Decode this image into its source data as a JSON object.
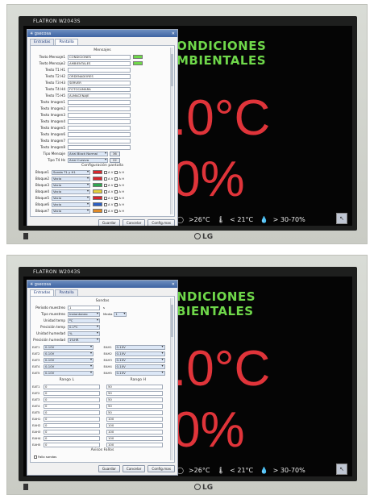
{
  "monitor": {
    "brand": "FLATRON",
    "model": "W2043S",
    "logo": "LG"
  },
  "background": {
    "title_line1": "NDICIONES",
    "title_line2": "BIENTALES",
    "title_line1_top": "ONDICIONES",
    "title_line2_top": "MBIENTALES",
    "temperature": ".0°C",
    "humidity": "0%",
    "legend": {
      "hot": ">26°C",
      "cold": "< 21°C",
      "humidity": "> 30-70%"
    },
    "colors": {
      "title": "#6fd84a",
      "value": "#e0343a"
    }
  },
  "dialog": {
    "title": "gsecosa",
    "tabs": [
      "Entradas",
      "Pantalla"
    ],
    "buttons": {
      "save": "Guardar",
      "cancel": "Cancelar",
      "config": "Config.mas"
    }
  },
  "pantalla": {
    "section_messages": "Mensajes",
    "texts": [
      {
        "label": "Texto Mensaje1",
        "value": "CONDICIONES"
      },
      {
        "label": "Texto Mensaje2",
        "value": "AMBIENTALES"
      },
      {
        "label": "Texto T1 H1",
        "value": ""
      },
      {
        "label": "Texto T2 H2",
        "value": "ORDENADORES"
      },
      {
        "label": "Texto T3 H3",
        "value": "SERVER"
      },
      {
        "label": "Texto T4 H4",
        "value": "FOTOCAMARA"
      },
      {
        "label": "Texto T5 H5",
        "value": "ALMACENAJE"
      },
      {
        "label": "Texto Imagen1",
        "value": ""
      },
      {
        "label": "Texto Imagen2",
        "value": ""
      },
      {
        "label": "Texto Imagen3",
        "value": ""
      },
      {
        "label": "Texto Imagen4",
        "value": ""
      },
      {
        "label": "Texto Imagen5",
        "value": ""
      },
      {
        "label": "Texto Imagen6",
        "value": ""
      },
      {
        "label": "Texto Imagen7",
        "value": ""
      },
      {
        "label": "Texto Imagen8",
        "value": ""
      }
    ],
    "tipo_mensaje": {
      "label": "Tipo Mensaje",
      "value": "Arial Black Normal",
      "size": "36"
    },
    "tipo_th": {
      "label": "Tipo T4 Hs",
      "value": "Arial Cursiva",
      "size": "22"
    },
    "section_config": "Configuración pantalla",
    "bloques": [
      {
        "label": "Bloque1",
        "value": "Sonda T1 y H1",
        "color": "#d8272d"
      },
      {
        "label": "Bloque2",
        "value": "Vacio",
        "color": "#d8272d"
      },
      {
        "label": "Bloque3",
        "value": "Vacio",
        "color": "#2fa84f"
      },
      {
        "label": "Bloque4",
        "value": "Vacio",
        "color": "#e4d23a"
      },
      {
        "label": "Bloque5",
        "value": "Vacio",
        "color": "#d8272d"
      },
      {
        "label": "Bloque6",
        "value": "Vacio",
        "color": "#2b5fc4"
      },
      {
        "label": "Bloque7",
        "value": "Vacio",
        "color": "#e08a26"
      }
    ],
    "chk_a": "A V",
    "chk_b": "A H"
  },
  "entradas": {
    "section_sondas": "Sondas",
    "periodo": {
      "label": "Periodo muestreo",
      "value": "1",
      "unit": "s"
    },
    "tipo_muestreo": {
      "label": "Tipo muestreo",
      "value": "Instantaneo",
      "media_label": "Media",
      "media_value": "1"
    },
    "unidad_temp": {
      "label": "Unidad temp",
      "value": "ºC"
    },
    "precision_temp": {
      "label": "Precisión temp",
      "value": "0.1ºC"
    },
    "unidad_hum": {
      "label": "Unidad humedad",
      "value": "%"
    },
    "precision_hum": {
      "label": "Precisión humedad",
      "value": "1%HR"
    },
    "channels_left": [
      {
        "label": "EAT1",
        "value": "0-10V"
      },
      {
        "label": "EAT2",
        "value": "0-10V"
      },
      {
        "label": "EAT3",
        "value": "0-10V"
      },
      {
        "label": "EAT4",
        "value": "0-10V"
      },
      {
        "label": "EAT5",
        "value": "0-10V"
      }
    ],
    "channels_right": [
      {
        "label": "EAH1",
        "value": "0-10V"
      },
      {
        "label": "EAH2",
        "value": "0-10V"
      },
      {
        "label": "EAH3",
        "value": "0-10V"
      },
      {
        "label": "EAH4",
        "value": "0-10V"
      },
      {
        "label": "EAH5",
        "value": "0-10V"
      }
    ],
    "rango_l": "Rango L",
    "rango_h": "Rango H",
    "ranges": [
      {
        "label": "EAT1",
        "l": "0",
        "h": "50"
      },
      {
        "label": "EAT2",
        "l": "0",
        "h": "50"
      },
      {
        "label": "EAT3",
        "l": "0",
        "h": "50"
      },
      {
        "label": "EAT4",
        "l": "0",
        "h": "50"
      },
      {
        "label": "EAT5",
        "l": "0",
        "h": "50"
      },
      {
        "label": "EAH1",
        "l": "0",
        "h": "100"
      },
      {
        "label": "EAH2",
        "l": "0",
        "h": "100"
      },
      {
        "label": "EAH3",
        "l": "0",
        "h": "100"
      },
      {
        "label": "EAH4",
        "l": "0",
        "h": "100"
      },
      {
        "label": "EAH5",
        "l": "0",
        "h": "100"
      }
    ],
    "section_fallos": "Avisos Fallos",
    "fallo_sondas": "Fallo sondas"
  }
}
